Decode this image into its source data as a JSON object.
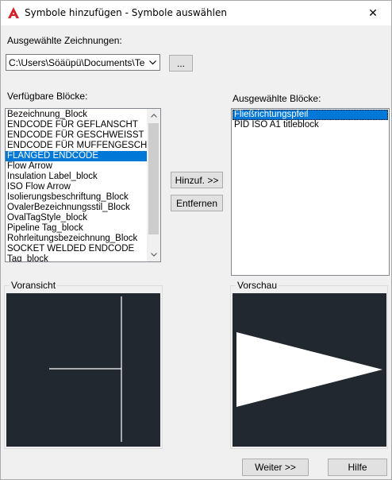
{
  "window": {
    "title": "Symbole hinzufügen - Symbole auswählen",
    "close_glyph": "✕"
  },
  "drawings": {
    "label": "Ausgewählte Zeichnungen:",
    "combo_value": "C:\\Users\\Söäüpü\\Documents\\TestI",
    "browse_label": "..."
  },
  "available": {
    "label": "Verfügbare Blöcke:",
    "items": [
      "Bezeichnung_Block",
      "ENDCODE FÜR GEFLANSCHT",
      "ENDCODE FÜR GESCHWEISST",
      "ENDCODE FÜR MUFFENGESCHWE",
      "FLANGED ENDCODE",
      "Flow Arrow",
      "Insulation Label_block",
      "ISO Flow Arrow",
      "Isolierungsbeschriftung_Block",
      "OvalerBezeichnungsstil_Block",
      "OvalTagStyle_block",
      "Pipeline Tag_block",
      "Rohrleitungsbezeichnung_Block",
      "SOCKET WELDED ENDCODE",
      "Tag_block"
    ],
    "selected_index": 4
  },
  "actions": {
    "add_label": "Hinzuf. >>",
    "remove_label": "Entfernen"
  },
  "selected": {
    "label": "Ausgewählte Blöcke:",
    "items": [
      "Fließrichtungspfeil",
      "PID ISO A1 titleblock"
    ],
    "selected_index": 0
  },
  "preview_left": {
    "title": "Voransicht",
    "background": "#212830"
  },
  "preview_right": {
    "title": "Vorschau",
    "background": "#212830"
  },
  "footer": {
    "next_label": "Weiter >>",
    "help_label": "Hilfe"
  },
  "colors": {
    "selection": "#0078d7",
    "brand_red": "#d2232a"
  }
}
